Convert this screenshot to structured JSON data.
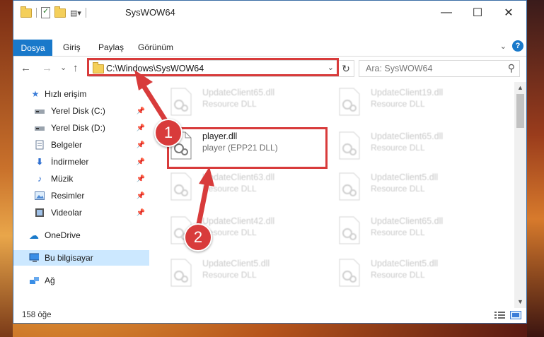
{
  "window": {
    "title": "SysWOW64",
    "controls": [
      "—",
      "☐",
      "✕"
    ]
  },
  "ribbon": {
    "tabs": [
      "Dosya",
      "Giriş",
      "Paylaş",
      "Görünüm"
    ],
    "help_label": "?"
  },
  "nav": {
    "back": "←",
    "forward": "→",
    "recent": "⌄",
    "up": "↑",
    "address": "C:\\Windows\\SysWOW64",
    "refresh": "↻",
    "search_placeholder": "Ara: SysWOW64"
  },
  "sidebar": {
    "items": [
      {
        "label": "Hızlı erişim",
        "icon": "star-icon",
        "pinned": false
      },
      {
        "label": "Yerel Disk (C:)",
        "icon": "drive-icon",
        "pinned": true
      },
      {
        "label": "Yerel Disk (D:)",
        "icon": "drive-icon",
        "pinned": true
      },
      {
        "label": "Belgeler",
        "icon": "documents-icon",
        "pinned": true
      },
      {
        "label": "İndirmeler",
        "icon": "download-icon",
        "pinned": true
      },
      {
        "label": "Müzik",
        "icon": "music-icon",
        "pinned": true
      },
      {
        "label": "Resimler",
        "icon": "pictures-icon",
        "pinned": true
      },
      {
        "label": "Videolar",
        "icon": "video-icon",
        "pinned": true
      },
      {
        "label": "OneDrive",
        "icon": "cloud-icon",
        "pinned": false
      },
      {
        "label": "Bu bilgisayar",
        "icon": "computer-icon",
        "pinned": false
      },
      {
        "label": "Ağ",
        "icon": "network-icon",
        "pinned": false
      }
    ]
  },
  "files": {
    "left": [
      {
        "name": "UpdateClient65.dll",
        "desc": "Resource DLL"
      },
      {
        "name": "player.dll",
        "desc": "player (EPP21 DLL)"
      },
      {
        "name": "UpdateClient63.dll",
        "desc": "Resource DLL"
      },
      {
        "name": "UpdateClient42.dll",
        "desc": "Resource DLL"
      },
      {
        "name": "UpdateClient5.dll",
        "desc": "Resource DLL"
      }
    ],
    "right": [
      {
        "name": "UpdateClient19.dll",
        "desc": "Resource DLL"
      },
      {
        "name": "UpdateClient65.dll",
        "desc": "Resource DLL"
      },
      {
        "name": "UpdateClient5.dll",
        "desc": "Resource DLL"
      },
      {
        "name": "UpdateClient65.dll",
        "desc": "Resource DLL"
      },
      {
        "name": "UpdateClient5.dll",
        "desc": "Resource DLL"
      }
    ]
  },
  "status": {
    "item_count": "158 öğe"
  },
  "annotations": {
    "step1": "1",
    "step2": "2"
  },
  "colors": {
    "accent": "#1979ca",
    "highlight": "#d83b3b",
    "selection": "#cce8ff"
  }
}
